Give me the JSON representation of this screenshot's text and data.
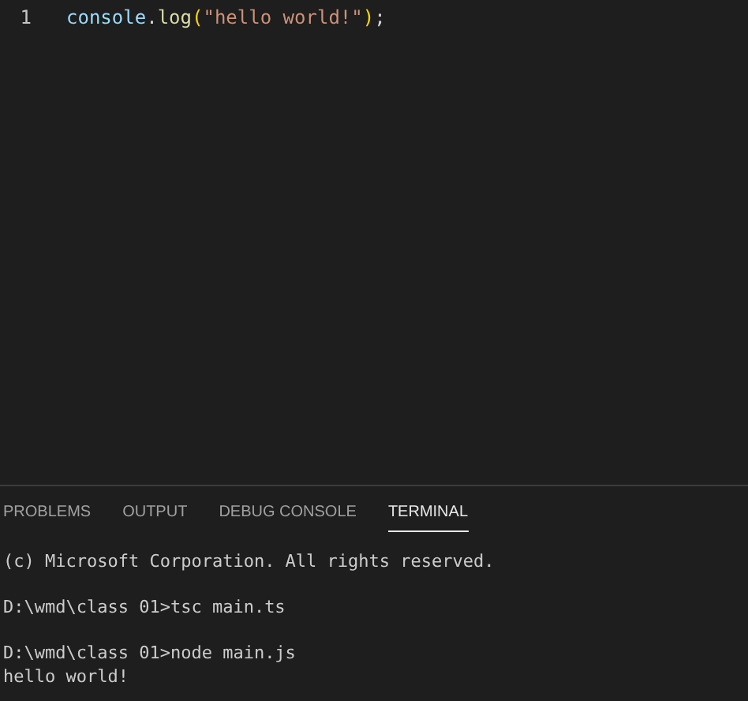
{
  "editor": {
    "lines": [
      {
        "number": "1",
        "tokens": [
          {
            "kind": "variable",
            "text": "console"
          },
          {
            "kind": "punctuation",
            "text": "."
          },
          {
            "kind": "function",
            "text": "log"
          },
          {
            "kind": "bracket",
            "text": "("
          },
          {
            "kind": "string",
            "text": "\"hello world!\""
          },
          {
            "kind": "bracket",
            "text": ")"
          },
          {
            "kind": "punctuation",
            "text": ";"
          }
        ]
      }
    ]
  },
  "panel": {
    "tabs": [
      {
        "label": "PROBLEMS",
        "selected": false
      },
      {
        "label": "OUTPUT",
        "selected": false
      },
      {
        "label": "DEBUG CONSOLE",
        "selected": false
      },
      {
        "label": "TERMINAL",
        "selected": true
      }
    ],
    "terminal_blocks": [
      [
        "(c) Microsoft Corporation. All rights reserved."
      ],
      [
        "D:\\wmd\\class 01>tsc main.ts"
      ],
      [
        "D:\\wmd\\class 01>node main.js",
        "hello world!"
      ]
    ]
  }
}
